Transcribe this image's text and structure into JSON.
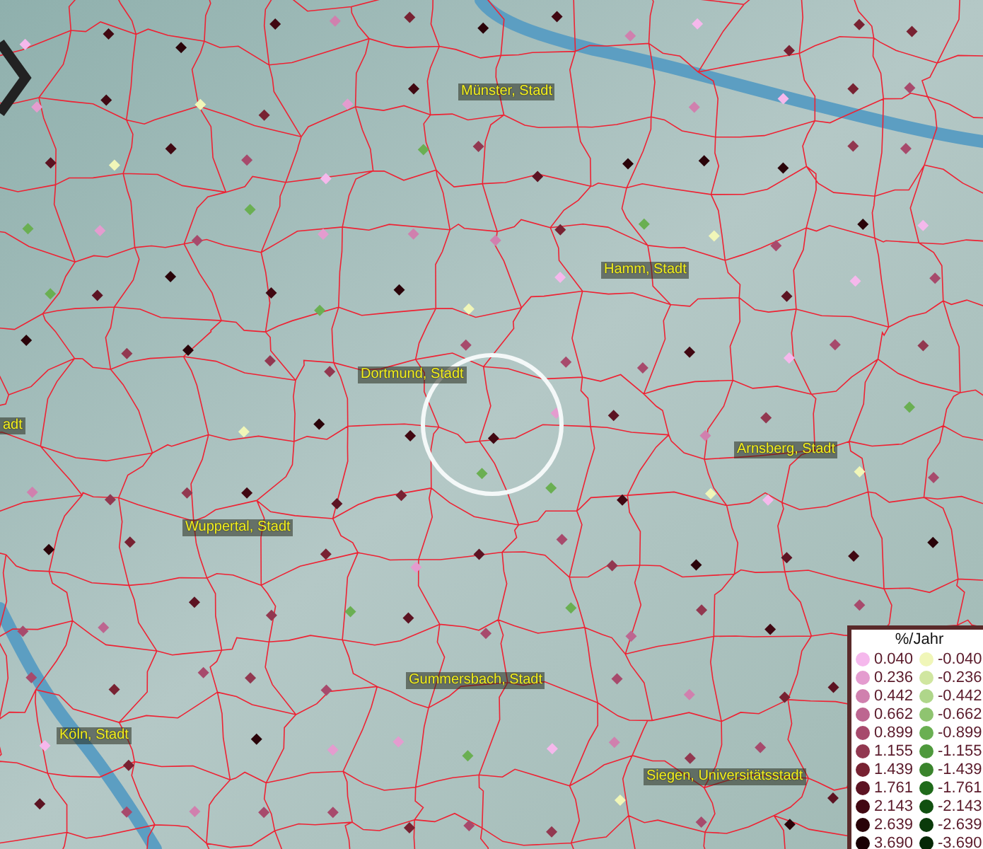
{
  "map": {
    "labels": [
      {
        "text": "Münster, Stadt"
      },
      {
        "text": "Hamm, Stadt"
      },
      {
        "text": "Dortmund, Stadt"
      },
      {
        "text": "adt"
      },
      {
        "text": "Arnsberg, Stadt"
      },
      {
        "text": "Wuppertal, Stadt"
      },
      {
        "text": "Gummersbach, Stadt"
      },
      {
        "text": "Köln, Stadt"
      },
      {
        "text": "Siegen, Universitätsstadt"
      }
    ]
  },
  "legend": {
    "title": "%/Jahr",
    "rows": [
      {
        "positive": {
          "value": "0.040",
          "color": "#f5b8ec"
        },
        "negative": {
          "value": "-0.040",
          "color": "#f0f6b8"
        }
      },
      {
        "positive": {
          "value": "0.236",
          "color": "#e49ccf"
        },
        "negative": {
          "value": "-0.236",
          "color": "#d0e6a0"
        }
      },
      {
        "positive": {
          "value": "0.442",
          "color": "#d080ae"
        },
        "negative": {
          "value": "-0.442",
          "color": "#afd68a"
        }
      },
      {
        "positive": {
          "value": "0.662",
          "color": "#bd6690"
        },
        "negative": {
          "value": "-0.662",
          "color": "#8fc470"
        }
      },
      {
        "positive": {
          "value": "0.899",
          "color": "#a74a6c"
        },
        "negative": {
          "value": "-0.899",
          "color": "#6aaf52"
        }
      },
      {
        "positive": {
          "value": "1.155",
          "color": "#923850"
        },
        "negative": {
          "value": "-1.155",
          "color": "#4e993c"
        }
      },
      {
        "positive": {
          "value": "1.439",
          "color": "#782232"
        },
        "negative": {
          "value": "-1.439",
          "color": "#3a842c"
        }
      },
      {
        "positive": {
          "value": "1.761",
          "color": "#5c1322"
        },
        "negative": {
          "value": "-1.761",
          "color": "#1f6a1a"
        }
      },
      {
        "positive": {
          "value": "2.143",
          "color": "#410812"
        },
        "negative": {
          "value": "-2.143",
          "color": "#115010"
        }
      },
      {
        "positive": {
          "value": "2.639",
          "color": "#2a0309"
        },
        "negative": {
          "value": "-2.639",
          "color": "#0a3a0a"
        }
      },
      {
        "positive": {
          "value": "3.690",
          "color": "#1a0004"
        },
        "negative": {
          "value": "-3.690",
          "color": "#062806"
        }
      }
    ]
  }
}
